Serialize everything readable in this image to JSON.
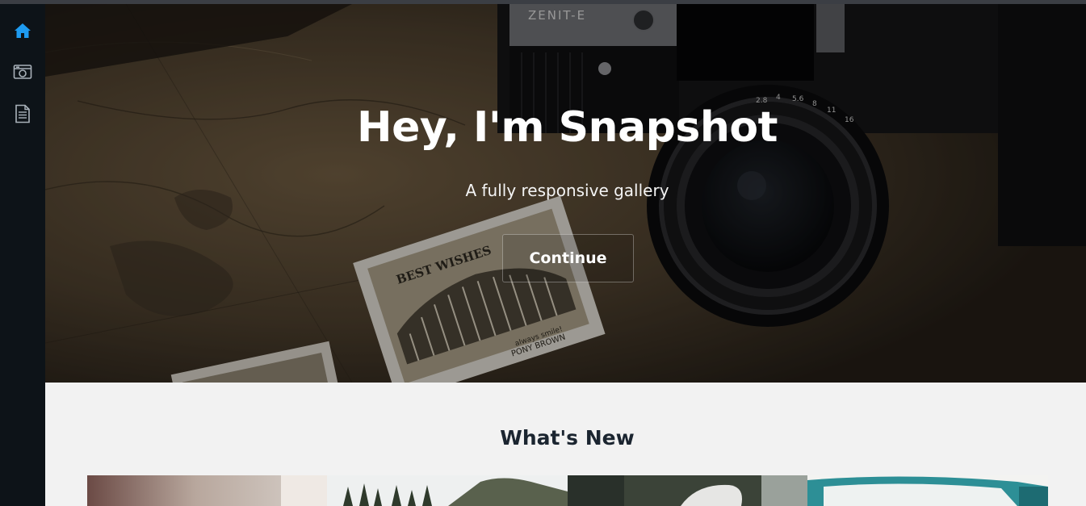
{
  "sidebar": {
    "items": [
      {
        "name": "home",
        "icon": "home-icon",
        "active": true
      },
      {
        "name": "gallery",
        "icon": "camera-icon",
        "active": false
      },
      {
        "name": "document",
        "icon": "document-icon",
        "active": false
      }
    ],
    "active_color": "#1e9bf0",
    "icon_color": "#a9b2ba"
  },
  "hero": {
    "title": "Hey, I'm Snapshot",
    "subtitle": "A fully responsive gallery",
    "button_label": "Continue",
    "photo_text": {
      "camera_brand": "ZENIT-E",
      "postcard_heading": "BEST WISHES",
      "postcard_line1": "always smile!",
      "postcard_line2": "PONY BROWN"
    }
  },
  "whats_new": {
    "title": "What's New",
    "thumbnails": [
      {
        "name": "thumb-1"
      },
      {
        "name": "thumb-2"
      },
      {
        "name": "thumb-3"
      },
      {
        "name": "thumb-4"
      }
    ]
  }
}
